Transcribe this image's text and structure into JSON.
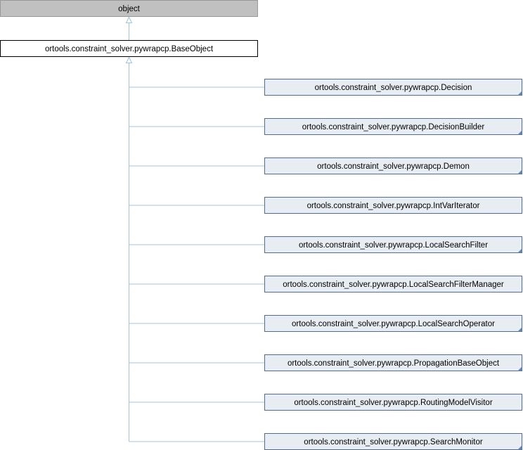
{
  "diagram": {
    "root": {
      "label": "object",
      "fill": "#c0c0c0",
      "stroke": "#999999"
    },
    "base": {
      "label": "ortools.constraint_solver.pywrapcp.BaseObject",
      "fill": "#ffffff",
      "stroke": "#000000"
    },
    "children": [
      {
        "label": "ortools.constraint_solver.pywrapcp.Decision",
        "has_subclasses": true
      },
      {
        "label": "ortools.constraint_solver.pywrapcp.DecisionBuilder",
        "has_subclasses": true
      },
      {
        "label": "ortools.constraint_solver.pywrapcp.Demon",
        "has_subclasses": true
      },
      {
        "label": "ortools.constraint_solver.pywrapcp.IntVarIterator",
        "has_subclasses": false
      },
      {
        "label": "ortools.constraint_solver.pywrapcp.LocalSearchFilter",
        "has_subclasses": true
      },
      {
        "label": "ortools.constraint_solver.pywrapcp.LocalSearchFilterManager",
        "has_subclasses": false
      },
      {
        "label": "ortools.constraint_solver.pywrapcp.LocalSearchOperator",
        "has_subclasses": true
      },
      {
        "label": "ortools.constraint_solver.pywrapcp.PropagationBaseObject",
        "has_subclasses": true
      },
      {
        "label": "ortools.constraint_solver.pywrapcp.RoutingModelVisitor",
        "has_subclasses": false
      },
      {
        "label": "ortools.constraint_solver.pywrapcp.SearchMonitor",
        "has_subclasses": true
      }
    ],
    "colors": {
      "child_fill": "#e8edf3",
      "child_stroke": "#556b8b",
      "edge": "#9fc4de",
      "corner_marker": "#6383b3"
    }
  }
}
